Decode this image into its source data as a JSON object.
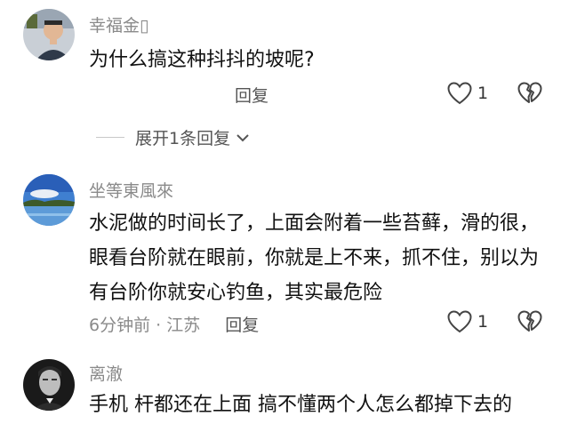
{
  "comments": [
    {
      "username": "幸福金⁠▯",
      "text": "为什么搞这种抖抖的坡呢?",
      "meta": "",
      "reply_label": "回复",
      "likes": "1",
      "replies_toggle": "展开1条回复"
    },
    {
      "username": "坐等東風來",
      "text": "水泥做的时间长了，上面会附着一些苔藓，滑的很，眼看台阶就在眼前，你就是上不来，抓不住，别以为有台阶你就安心钓鱼，其实最危险",
      "meta": "6分钟前 · 江苏",
      "reply_label": "回复",
      "likes": "1"
    },
    {
      "username": "离澈",
      "text": "手机 杆都还在上面  搞不懂两个人怎么都掉下去的"
    }
  ],
  "colors": {
    "secondary_text": "#8a8a8a",
    "primary_text": "#111111",
    "icon_stroke": "#444444"
  },
  "icons": [
    "heart-icon",
    "broken-heart-icon",
    "chevron-down-icon"
  ]
}
